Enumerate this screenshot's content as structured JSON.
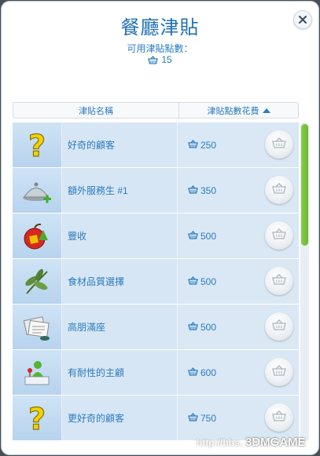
{
  "dialog": {
    "title": "餐廳津貼",
    "points_label": "可用津貼點數：",
    "points_value": "15"
  },
  "table": {
    "header_name": "津貼名稱",
    "header_cost": "津貼點數花費",
    "sort": "ascending"
  },
  "perks": [
    {
      "name": "好奇的顧客",
      "cost": "250",
      "icon": "question-mark-icon"
    },
    {
      "name": "額外服務生 #1",
      "cost": "350",
      "icon": "serving-cloche-icon"
    },
    {
      "name": "豐收",
      "cost": "500",
      "icon": "apple-icon"
    },
    {
      "name": "食材品質選擇",
      "cost": "500",
      "icon": "herb-leaves-icon"
    },
    {
      "name": "高朋滿座",
      "cost": "500",
      "icon": "paper-stack-icon"
    },
    {
      "name": "有耐性的主顧",
      "cost": "600",
      "icon": "patient-customer-icon"
    },
    {
      "name": "更好奇的顧客",
      "cost": "750",
      "icon": "question-mark-icon"
    }
  ],
  "watermark": {
    "text": "http://bbs.",
    "brand": "3DMGAME"
  },
  "colors": {
    "accent_blue": "#2a7bc0",
    "scroll_green": "#7cc23b",
    "row_bg": "#dae8f5"
  }
}
